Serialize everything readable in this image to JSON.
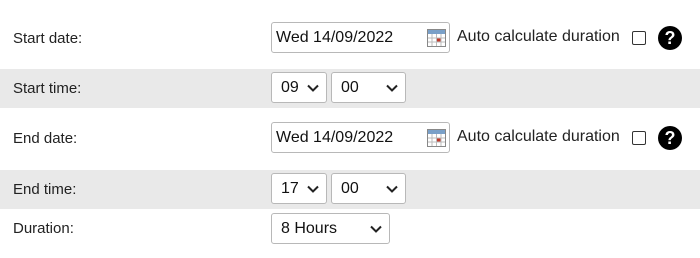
{
  "start": {
    "date_label": "Start date:",
    "date_value": "Wed 14/09/2022",
    "auto_label": "Auto calculate duration",
    "auto_checked": false,
    "time_label": "Start time:",
    "hour": "09",
    "minute": "00"
  },
  "end": {
    "date_label": "End date:",
    "date_value": "Wed 14/09/2022",
    "auto_label": "Auto calculate duration",
    "auto_checked": false,
    "time_label": "End time:",
    "hour": "17",
    "minute": "00"
  },
  "duration": {
    "label": "Duration:",
    "value": "8 Hours"
  },
  "help_glyph": "?",
  "colors": {
    "shaded_row": "#e9e9e9",
    "calendar_header": "#7aa0c8",
    "calendar_mark": "#c0392b"
  },
  "icons": [
    "calendar-icon",
    "help-icon",
    "chevron-down-icon"
  ]
}
